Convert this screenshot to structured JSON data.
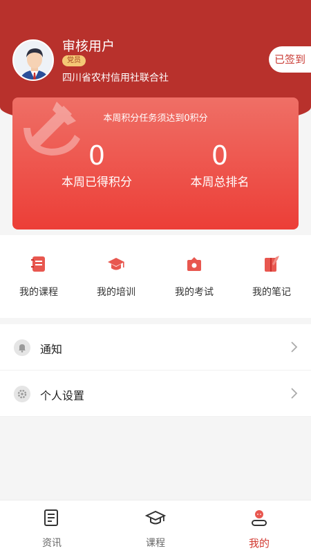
{
  "profile": {
    "username": "审核用户",
    "badge": "党员",
    "organization": "四川省农村信用社联合社",
    "signin_label": "已签到"
  },
  "score_card": {
    "task_text": "本周积分任务须达到0积分",
    "weekly_points_value": "0",
    "weekly_points_label": "本周已得积分",
    "weekly_rank_value": "0",
    "weekly_rank_label": "本周总排名"
  },
  "quick_actions": [
    {
      "label": "我的课程",
      "icon": "notebook-icon"
    },
    {
      "label": "我的培训",
      "icon": "graduation-cap-icon"
    },
    {
      "label": "我的考试",
      "icon": "exam-icon"
    },
    {
      "label": "我的笔记",
      "icon": "note-pen-icon"
    }
  ],
  "menu": [
    {
      "label": "通知",
      "icon": "bell-icon"
    },
    {
      "label": "个人设置",
      "icon": "gear-icon"
    }
  ],
  "tabbar": [
    {
      "label": "资讯",
      "icon": "news-icon",
      "active": false
    },
    {
      "label": "课程",
      "icon": "graduation-cap-icon",
      "active": false
    },
    {
      "label": "我的",
      "icon": "profile-icon",
      "active": true
    }
  ],
  "colors": {
    "header": "#b8312c",
    "accent": "#d23a32",
    "card_top": "#ef6f66",
    "card_bottom": "#ec3e37",
    "badge": "#f4c875"
  }
}
